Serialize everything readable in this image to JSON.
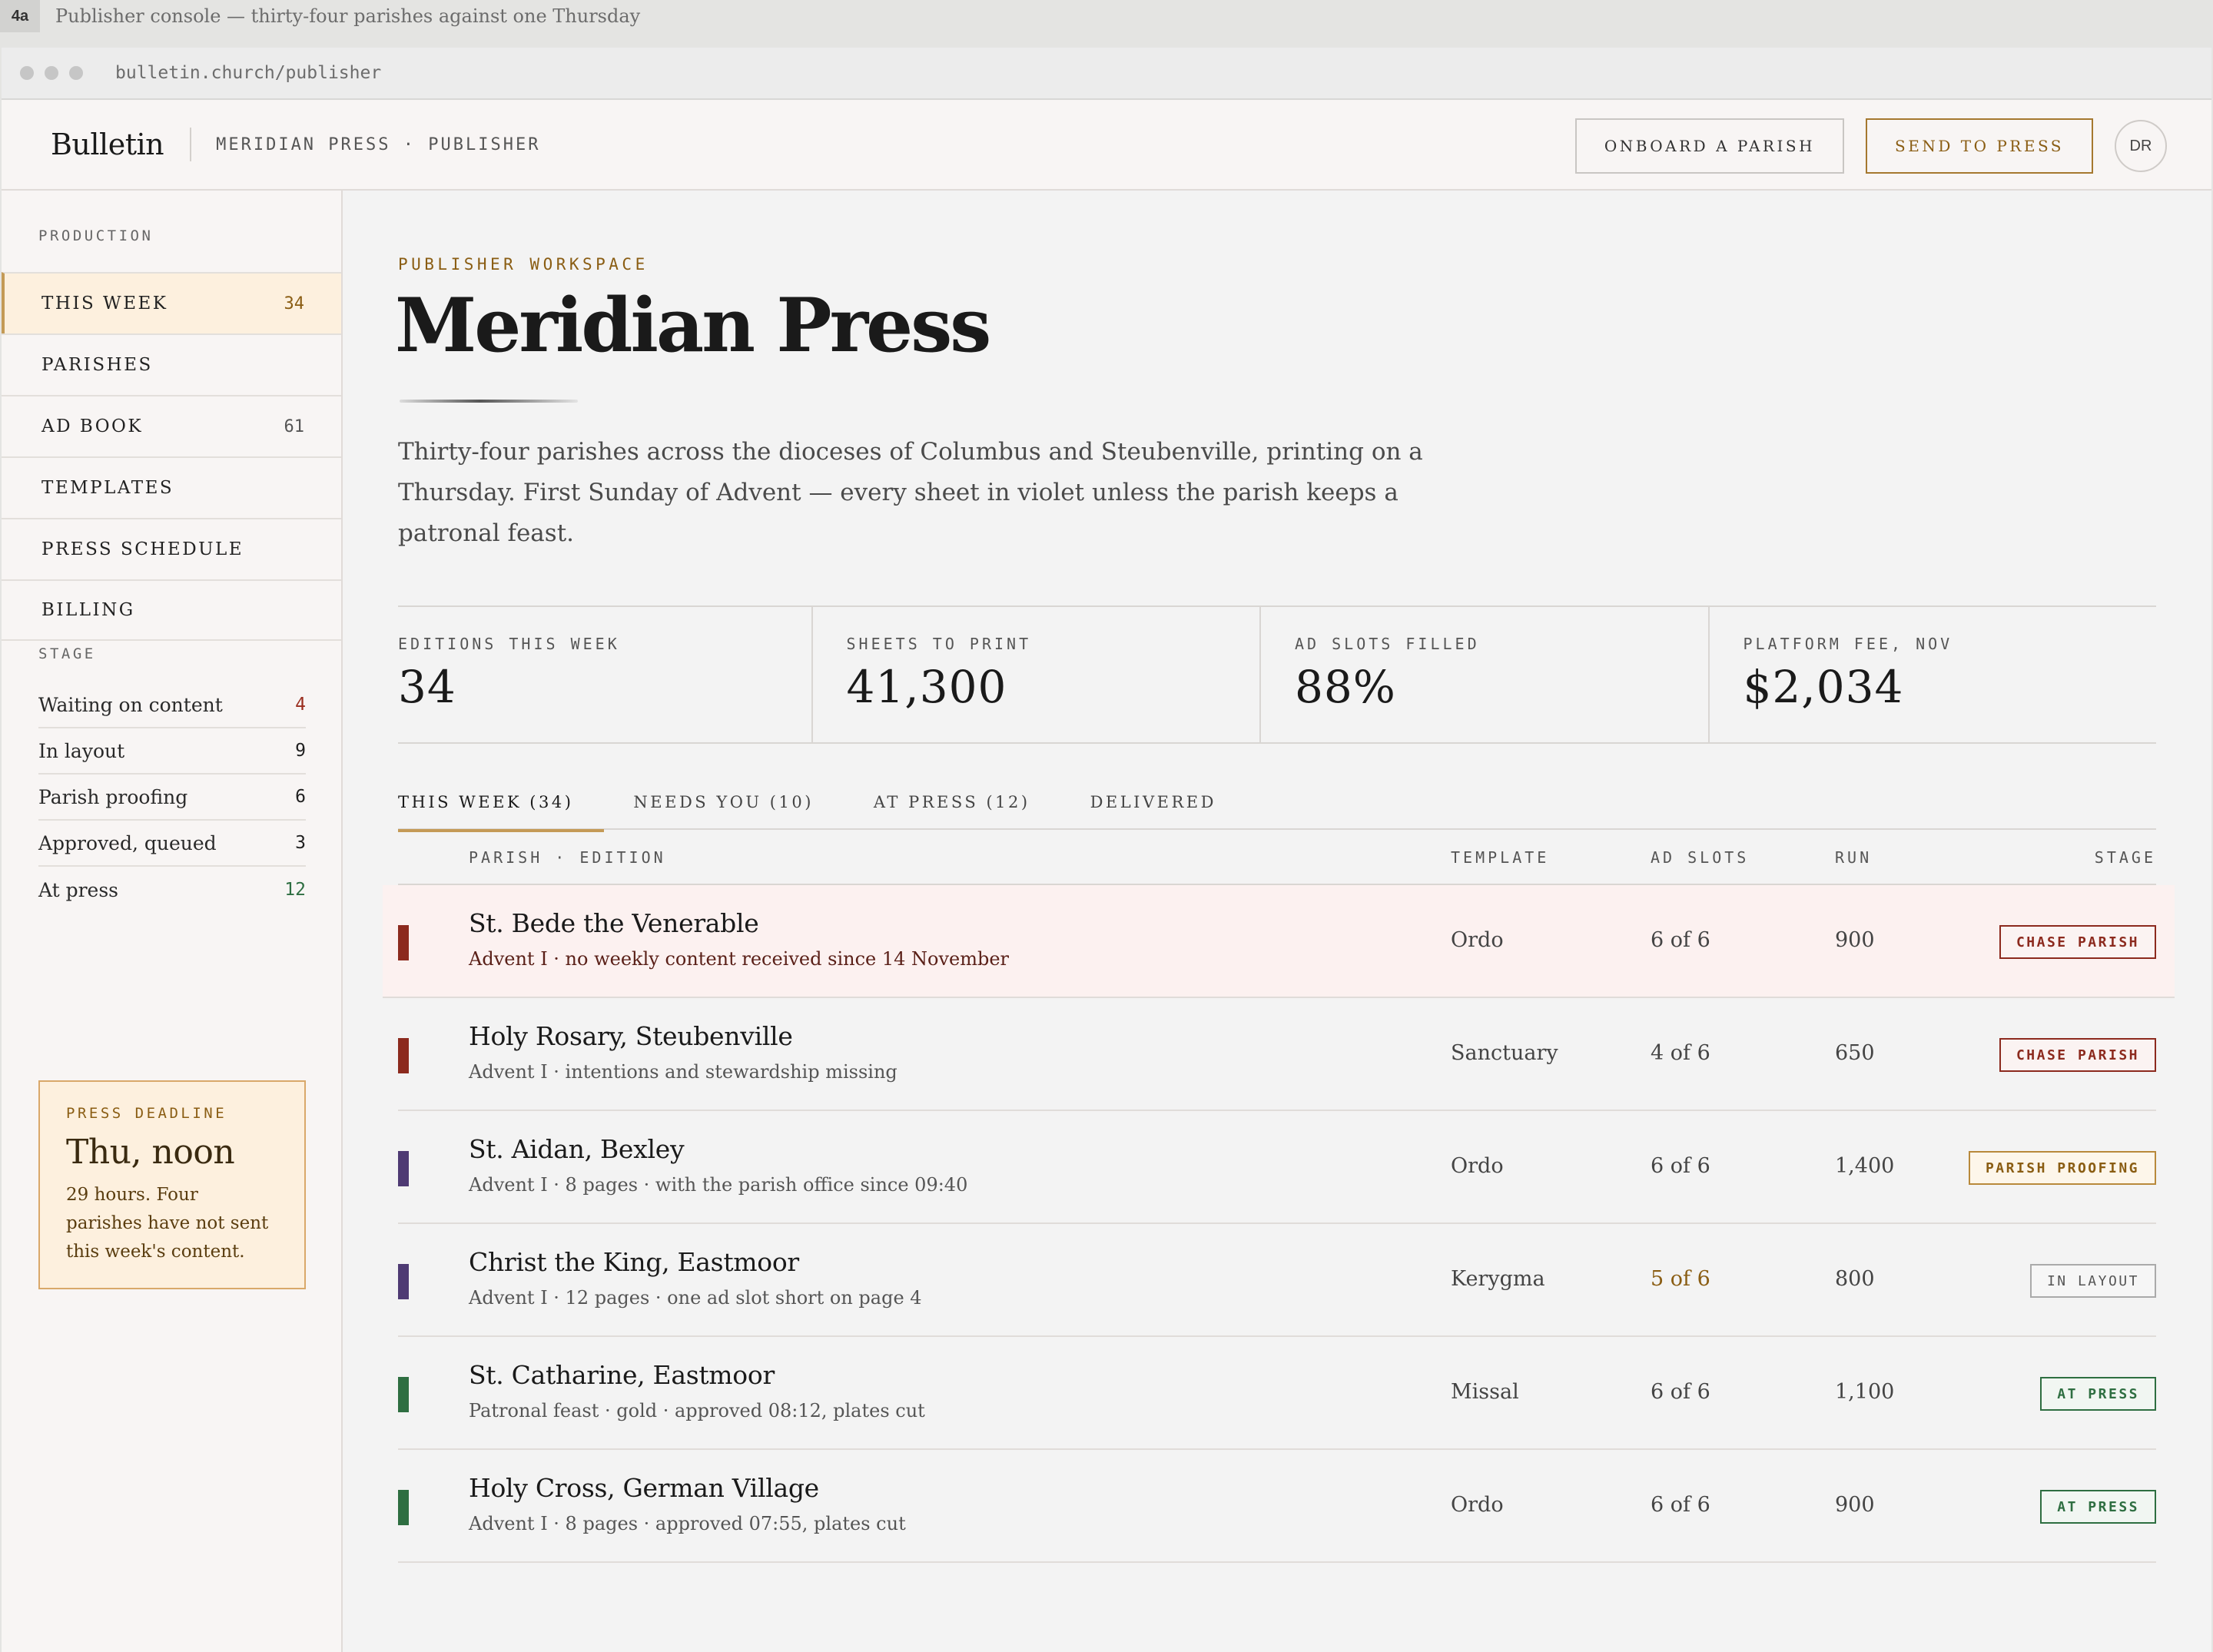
{
  "caption": {
    "tag": "4a",
    "text": "Publisher console — thirty-four parishes against one Thursday"
  },
  "browser": {
    "url": "bulletin.church/publisher"
  },
  "header": {
    "brand": "Bulletin",
    "subtitle": "MERIDIAN PRESS · PUBLISHER",
    "onboard_label": "ONBOARD A PARISH",
    "send_label": "SEND TO PRESS",
    "avatar_initials": "DR"
  },
  "sidebar": {
    "production_heading": "PRODUCTION",
    "nav": [
      {
        "label": "THIS WEEK",
        "count": "34",
        "active": true
      },
      {
        "label": "PARISHES",
        "count": ""
      },
      {
        "label": "AD BOOK",
        "count": "61"
      },
      {
        "label": "TEMPLATES",
        "count": ""
      },
      {
        "label": "PRESS SCHEDULE",
        "count": ""
      },
      {
        "label": "BILLING",
        "count": ""
      }
    ],
    "stage_heading": "STAGE",
    "stages": [
      {
        "label": "Waiting on content",
        "count": "4",
        "color": "#9a2e1f"
      },
      {
        "label": "In layout",
        "count": "9",
        "color": "#1f1f1f"
      },
      {
        "label": "Parish proofing",
        "count": "6",
        "color": "#1f1f1f"
      },
      {
        "label": "Approved, queued",
        "count": "3",
        "color": "#1f1f1f"
      },
      {
        "label": "At press",
        "count": "12",
        "color": "#2e6e41"
      }
    ],
    "deadline": {
      "heading": "PRESS DEADLINE",
      "when": "Thu, noon",
      "body": "29 hours. Four parishes have not sent this week's content."
    }
  },
  "main": {
    "eyebrow": "PUBLISHER WORKSPACE",
    "title": "Meridian Press",
    "lede": "Thirty-four parishes across the dioceses of Columbus and Steubenville, printing on a Thursday. First Sunday of Advent — every sheet in violet unless the parish keeps a patronal feast.",
    "stats": [
      {
        "label": "EDITIONS THIS WEEK",
        "value": "34"
      },
      {
        "label": "SHEETS TO PRINT",
        "value": "41,300"
      },
      {
        "label": "AD SLOTS FILLED",
        "value": "88%"
      },
      {
        "label": "PLATFORM FEE, NOV",
        "value": "$2,034"
      }
    ],
    "tabs": [
      {
        "label": "THIS WEEK (34)",
        "active": true
      },
      {
        "label": "NEEDS YOU (10)"
      },
      {
        "label": "AT PRESS (12)"
      },
      {
        "label": "DELIVERED"
      }
    ],
    "columns": {
      "parish": "PARISH · EDITION",
      "template": "TEMPLATE",
      "ad_slots": "AD SLOTS",
      "run": "RUN",
      "stage": "STAGE"
    },
    "rows": [
      {
        "name": "St. Bede the Venerable",
        "sub": "Advent I · no weekly content received since 14 November",
        "template": "Ordo",
        "ad_slots": "6 of 6",
        "run": "900",
        "stage": "CHASE PARISH",
        "kind": "chase",
        "bar": "#8c2a1e",
        "alert": true
      },
      {
        "name": "Holy Rosary, Steubenville",
        "sub": "Advent I · intentions and stewardship missing",
        "template": "Sanctuary",
        "ad_slots": "4 of 6",
        "run": "650",
        "stage": "CHASE PARISH",
        "kind": "chase",
        "bar": "#8c2a1e"
      },
      {
        "name": "St. Aidan, Bexley",
        "sub": "Advent I · 8 pages · with the parish office since 09:40",
        "template": "Ordo",
        "ad_slots": "6 of 6",
        "run": "1,400",
        "stage": "PARISH PROOFING",
        "kind": "proof",
        "bar": "#4e3a73"
      },
      {
        "name": "Christ the King, Eastmoor",
        "sub": "Advent I · 12 pages · one ad slot short on page 4",
        "template": "Kerygma",
        "ad_slots": "5 of 6",
        "run": "800",
        "stage": "IN LAYOUT",
        "kind": "layout",
        "bar": "#4e3a73",
        "short": true
      },
      {
        "name": "St. Catharine, Eastmoor",
        "sub": "Patronal feast · gold · approved 08:12, plates cut",
        "template": "Missal",
        "ad_slots": "6 of 6",
        "run": "1,100",
        "stage": "AT PRESS",
        "kind": "press",
        "bar": "#2e6e41"
      },
      {
        "name": "Holy Cross, German Village",
        "sub": "Advent I · 8 pages · approved 07:55, plates cut",
        "template": "Ordo",
        "ad_slots": "6 of 6",
        "run": "900",
        "stage": "AT PRESS",
        "kind": "press",
        "bar": "#2e6e41"
      }
    ]
  }
}
